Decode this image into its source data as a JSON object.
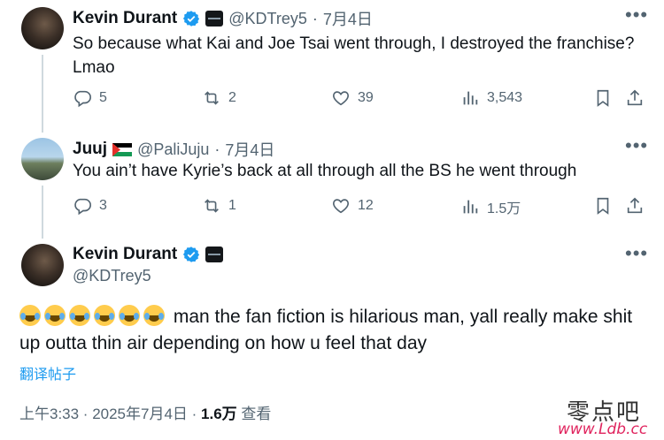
{
  "tweets": [
    {
      "display_name": "Kevin Durant",
      "handle": "@KDTrey5",
      "separator": "·",
      "date": "7月4日",
      "text": "So because what Kai and Joe Tsai went through, I destroyed the franchise? Lmao",
      "replies": "5",
      "reposts": "2",
      "likes": "39",
      "views": "3,543"
    },
    {
      "display_name": "Juuj",
      "handle": "@PaliJuju",
      "separator": "·",
      "date": "7月4日",
      "text": "You ain’t have Kyrie’s back at all through all the BS he went through",
      "replies": "3",
      "reposts": "1",
      "likes": "12",
      "views": "1.5万"
    }
  ],
  "main_tweet": {
    "display_name": "Kevin Durant",
    "handle": "@KDTrey5",
    "text": "man the fan fiction is hilarious man, yall really make shit up outta thin air depending on how u feel that day",
    "emoji_count": 6,
    "translate_label": "翻译帖子",
    "timestamp": "上午3:33 · 2025年7月4日 · ",
    "views_count": "1.6万",
    "views_label": " 查看"
  },
  "watermark": {
    "text_cn": "零点吧",
    "url": "www.Ldb.cc"
  },
  "colors": {
    "text": "#0f1419",
    "muted": "#536471",
    "link": "#1d9bf0",
    "verified": "#1d9bf0",
    "thread_line": "#cfd9de"
  }
}
